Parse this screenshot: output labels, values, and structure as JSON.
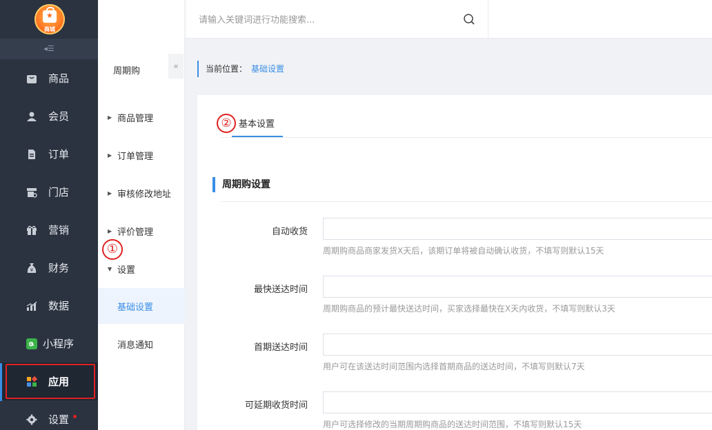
{
  "logo": {
    "text": "商城"
  },
  "sidebar": {
    "items": [
      {
        "label": "商品",
        "icon": "bag-icon"
      },
      {
        "label": "会员",
        "icon": "user-icon"
      },
      {
        "label": "订单",
        "icon": "document-icon"
      },
      {
        "label": "门店",
        "icon": "store-icon"
      },
      {
        "label": "营销",
        "icon": "gift-icon"
      },
      {
        "label": "财务",
        "icon": "money-bag-icon"
      },
      {
        "label": "数据",
        "icon": "bar-chart-icon"
      },
      {
        "label": "小程序",
        "icon": "mini-program-icon"
      },
      {
        "label": "应用",
        "icon": "apps-icon",
        "active": true
      },
      {
        "label": "设置",
        "icon": "gear-icon"
      }
    ],
    "accent_color": "#3a8ee6",
    "annotation_color": "#e02020"
  },
  "subnav": {
    "title": "周期购",
    "fold_icon": "double-chevron-left-icon",
    "items": [
      {
        "label": "商品管理"
      },
      {
        "label": "订单管理"
      },
      {
        "label": "审核修改地址"
      },
      {
        "label": "评价管理"
      },
      {
        "label": "设置",
        "expanded": true
      },
      {
        "label": "基础设置",
        "selected": true
      },
      {
        "label": "消息通知"
      }
    ],
    "annotation": "①"
  },
  "topbar": {
    "home_icon": "home-icon",
    "menu_icon": "menu-icon",
    "search_placeholder": "请输入关键词进行功能搜索...",
    "search_icon": "search-icon"
  },
  "breadcrumb": {
    "prefix": "当前位置：",
    "current": "基础设置"
  },
  "tabs": {
    "active": "基本设置",
    "annotation": "②"
  },
  "section": {
    "title": "周期购设置",
    "fields": [
      {
        "label": "自动收货",
        "value": "",
        "help": "周期购商品商家发货X天后，该期订单将被自动确认收货，不填写则默认15天"
      },
      {
        "label": "最快送达时间",
        "value": "",
        "help": "周期购商品的预计最快送达时间，买家选择最快在X天内收货，不填写则默认3天"
      },
      {
        "label": "首期送达时间",
        "value": "",
        "help": "用户可在该送达时间范围内选择首期商品的送达时间，不填写则默认7天"
      },
      {
        "label": "可延期收货时间",
        "value": "",
        "help": "用户可选择修改的当期周期购商品的送达时间范围，不填写则默认15天"
      }
    ]
  }
}
